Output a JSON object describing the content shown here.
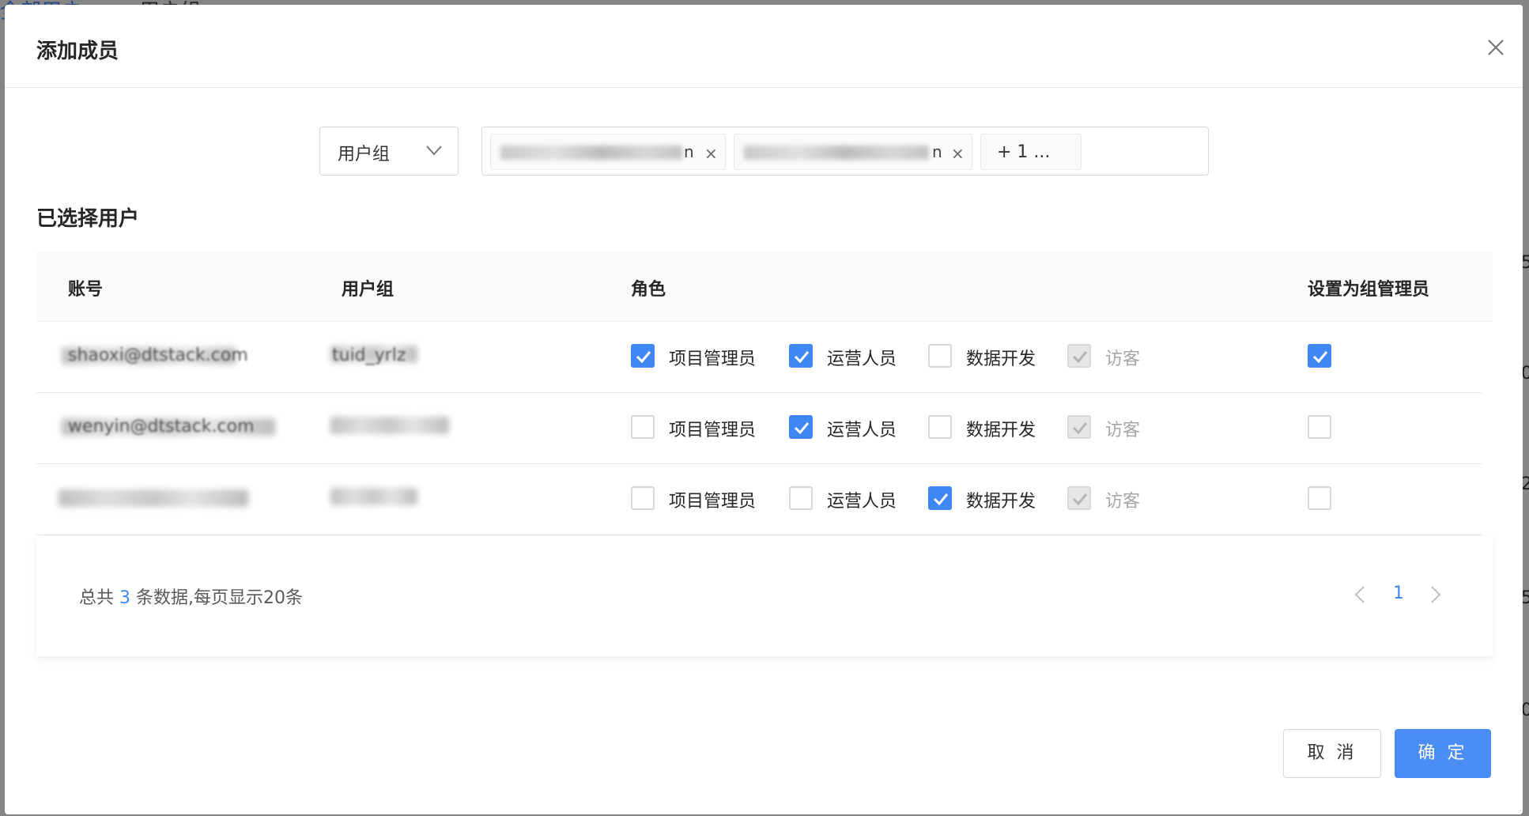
{
  "background": {
    "tabs": [
      "全部用户",
      "用户组"
    ],
    "side_digits": [
      "5",
      "0",
      "2",
      "5",
      "0"
    ]
  },
  "modal": {
    "title": "添加成员",
    "close_icon": "close-icon"
  },
  "filter": {
    "select_value": "用户组",
    "tags": [
      {
        "tail": "n",
        "remove": "×"
      },
      {
        "tail": "n",
        "remove": "×"
      }
    ],
    "more_label": "+ 1 ..."
  },
  "section_title": "已选择用户",
  "table": {
    "headers": {
      "account": "账号",
      "group": "用户组",
      "role": "角色",
      "admin": "设置为组管理员"
    },
    "roles": [
      "项目管理员",
      "运营人员",
      "数据开发",
      "访客"
    ],
    "rows": [
      {
        "account_fragment": "shaoxi@dtstack.com",
        "group_fragment": "tuid_yrlz",
        "roles": [
          true,
          true,
          false,
          true
        ],
        "admin": true
      },
      {
        "account_fragment": "wenyin@dtstack.com",
        "group_fragment": "",
        "roles": [
          false,
          true,
          false,
          true
        ],
        "admin": false
      },
      {
        "account_fragment": "",
        "group_fragment": "",
        "roles": [
          false,
          false,
          true,
          true
        ],
        "admin": false
      }
    ]
  },
  "pagination": {
    "total_prefix": "总共",
    "total_count": "3",
    "total_suffix": "条数据,每页显示20条",
    "current_page": "1"
  },
  "buttons": {
    "cancel": "取 消",
    "ok": "确 定"
  },
  "colors": {
    "primary": "#3f87f5",
    "border": "#d9d9d9",
    "header_bg": "#fafafa"
  }
}
